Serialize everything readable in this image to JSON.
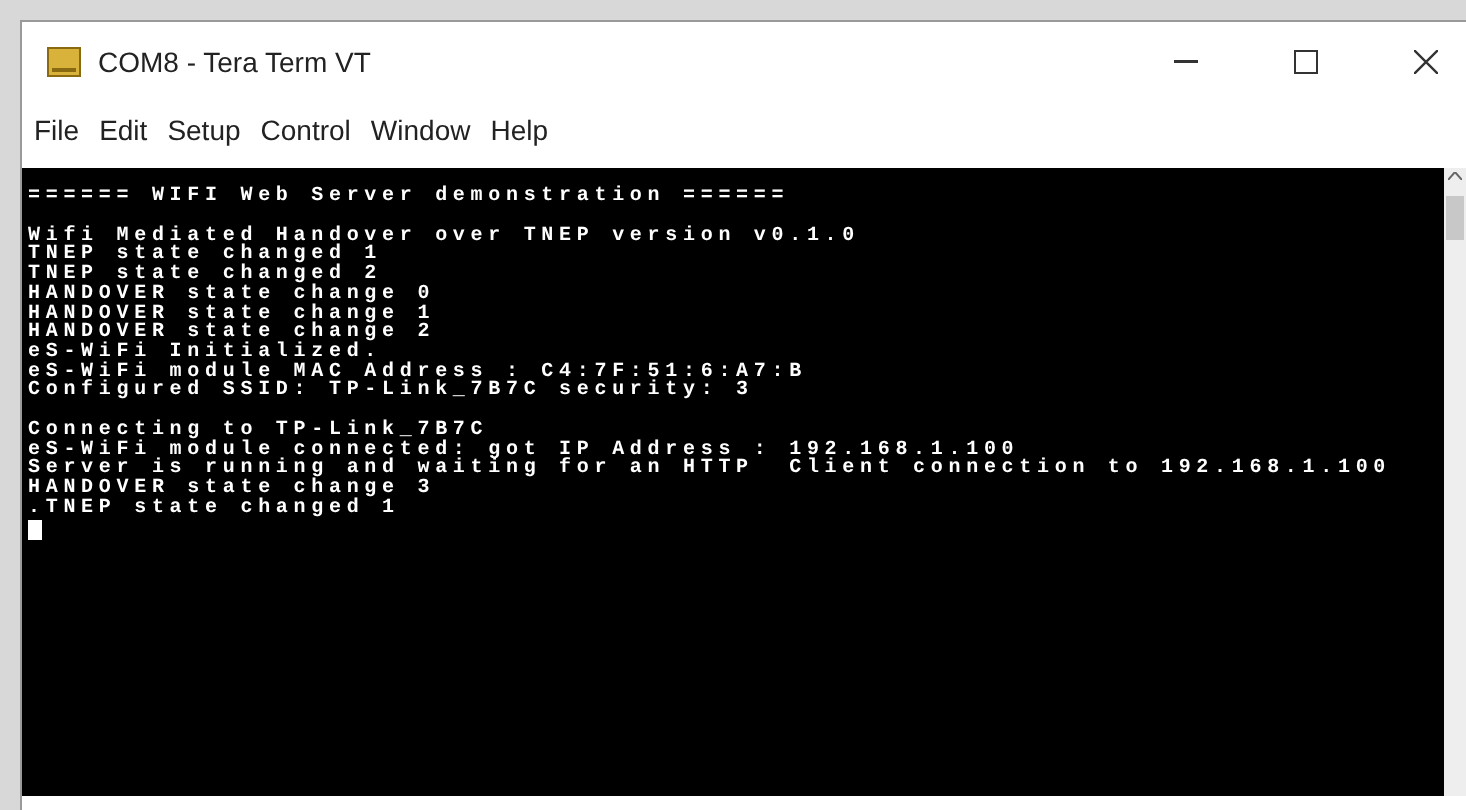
{
  "window": {
    "title": "COM8 - Tera Term VT"
  },
  "menu": [
    "File",
    "Edit",
    "Setup",
    "Control",
    "Window",
    "Help"
  ],
  "terminal": {
    "blocks": [
      [
        "====== WIFI Web Server demonstration ======"
      ],
      [
        "Wifi Mediated Handover over TNEP version v0.1.0",
        "TNEP state changed 1",
        "TNEP state changed 2",
        "HANDOVER state change 0",
        "HANDOVER state change 1",
        "HANDOVER state change 2",
        "eS-WiFi Initialized.",
        "eS-WiFi module MAC Address : C4:7F:51:6:A7:B",
        "Configured SSID: TP-Link_7B7C security: 3"
      ],
      [
        "Connecting to TP-Link_7B7C",
        "eS-WiFi module connected: got IP Address : 192.168.1.100",
        "Server is running and waiting for an HTTP  Client connection to 192.168.1.100",
        "HANDOVER state change 3",
        ".TNEP state changed 1"
      ]
    ],
    "cursor": true
  }
}
